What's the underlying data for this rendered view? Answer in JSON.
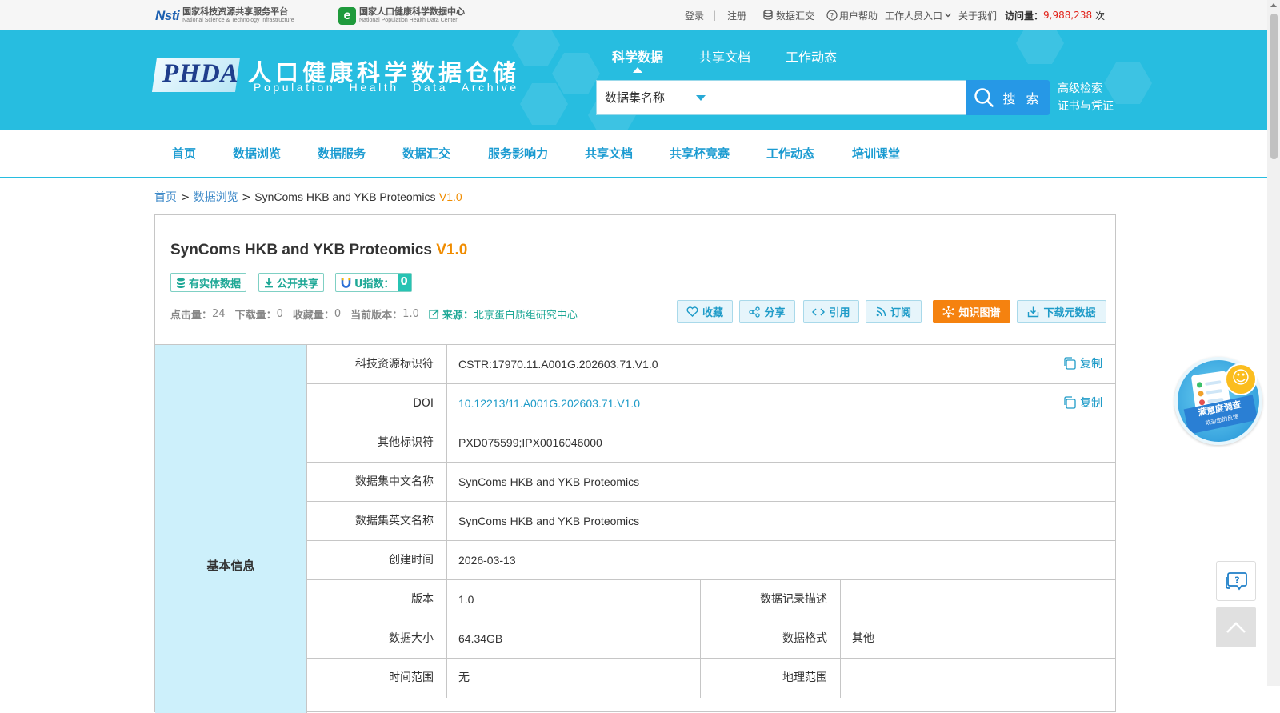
{
  "topbar": {
    "nsti_logo_mark": "Nsti",
    "nsti_cn": "国家科技资源共享服务平台",
    "nsti_en": "National Science & Technology Infrastructure",
    "phdc_logo_mark": "e",
    "phdc_cn": "国家人口健康科学数据中心",
    "phdc_en": "National Population Health Data Center",
    "login": "登录",
    "sep": "|",
    "register": "注册",
    "data_submit": "数据汇交",
    "help": "用户帮助",
    "staff": "工作人员入口",
    "about": "关于我们",
    "visits_label": "访问量：",
    "visits_value": "9,988,238",
    "visits_unit": "次"
  },
  "header": {
    "logo_mark": "PHDA",
    "title": "人口健康科学数据仓储",
    "subtitle": "Population Health Data Archive",
    "tabs": [
      "科学数据",
      "共享文档",
      "工作动态"
    ],
    "search_type": "数据集名称",
    "search_value": "",
    "search_button": "搜 索",
    "advanced_search": "高级检索",
    "certificate": "证书与凭证"
  },
  "nav": {
    "items": [
      "首页",
      "数据浏览",
      "数据服务",
      "数据汇交",
      "服务影响力",
      "共享文档",
      "共享杯竞赛",
      "工作动态",
      "培训课堂"
    ]
  },
  "breadcrumb": {
    "home": "首页",
    "sep": ">",
    "browse": "数据浏览",
    "current": "SynComs HKB and YKB Proteomics",
    "version": "V1.0"
  },
  "dataset": {
    "title": "SynComs HKB and YKB Proteomics",
    "version": "V1.0",
    "badges": {
      "entity": "有实体数据",
      "public": "公开共享",
      "u_label": "U指数：",
      "u_value": "0"
    },
    "stats": {
      "clicks_label": "点击量：",
      "clicks": "24",
      "downloads_label": "下载量：",
      "downloads": "0",
      "favorites_label": "收藏量：",
      "favorites": "0",
      "current_version_label": "当前版本：",
      "current_version": "1.0",
      "source_label": "来源：",
      "source": "北京蛋白质组研究中心"
    },
    "actions": {
      "favorite": "收藏",
      "share": "分享",
      "cite": "引用",
      "subscribe": "订阅",
      "knowledge_graph": "知识图谱",
      "download_meta": "下载元数据"
    }
  },
  "info": {
    "section": "基本信息",
    "copy_label": "复制",
    "rows": {
      "cstr_label": "科技资源标识符",
      "cstr": "CSTR:17970.11.A001G.202603.71.V1.0",
      "doi_label": "DOI",
      "doi": "10.12213/11.A001G.202603.71.V1.0",
      "other_id_label": "其他标识符",
      "other_id": "PXD075599;IPX0016046000",
      "cn_name_label": "数据集中文名称",
      "cn_name": "SynComs HKB and YKB Proteomics",
      "en_name_label": "数据集英文名称",
      "en_name": "SynComs HKB and YKB Proteomics",
      "created_label": "创建时间",
      "created": "2026-03-13",
      "version_label": "版本",
      "version": "1.0",
      "record_desc_label": "数据记录描述",
      "record_desc": "",
      "size_label": "数据大小",
      "size": "64.34GB",
      "format_label": "数据格式",
      "format": "其他",
      "time_range_label": "时间范围",
      "time_range": "无",
      "geo_range_label": "地理范围",
      "geo_range": ""
    }
  },
  "float": {
    "survey_title": "满意度调查",
    "survey_sub": "欢迎您的反馈"
  },
  "colors": {
    "banner": "#27bde0",
    "nav_text": "#1b9bd1",
    "accent_orange": "#f5820f",
    "version_orange": "#f08c00",
    "section_bg": "#cdf0fb",
    "teal": "#1ea896"
  }
}
